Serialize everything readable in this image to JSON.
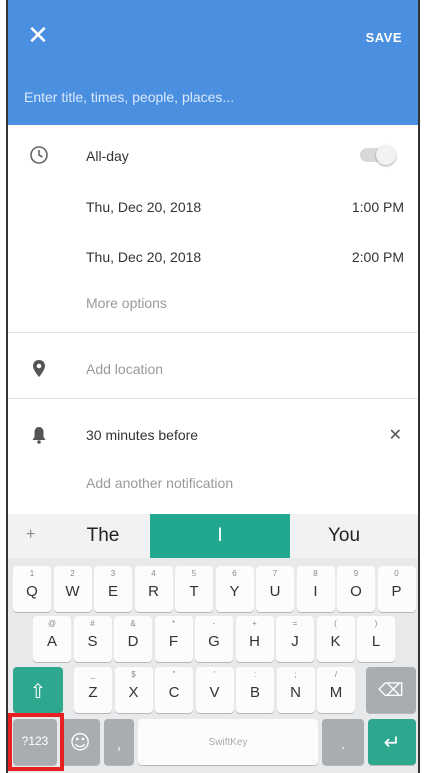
{
  "header": {
    "close_glyph": "✕",
    "save_label": "SAVE",
    "title_placeholder": "Enter title, times, people, places..."
  },
  "event": {
    "allday_label": "All-day",
    "allday_on": false,
    "start_date": "Thu, Dec 20, 2018",
    "start_time": "1:00 PM",
    "end_date": "Thu, Dec 20, 2018",
    "end_time": "2:00 PM",
    "more_options": "More options",
    "location_placeholder": "Add location",
    "notification": "30 minutes before",
    "notification_clear": "✕",
    "add_notification": "Add another notification"
  },
  "keyboard": {
    "suggestions": [
      "The",
      "I",
      "You"
    ],
    "row1": [
      {
        "k": "Q",
        "h": "1"
      },
      {
        "k": "W",
        "h": "2"
      },
      {
        "k": "E",
        "h": "3"
      },
      {
        "k": "R",
        "h": "4"
      },
      {
        "k": "T",
        "h": "5"
      },
      {
        "k": "Y",
        "h": "6"
      },
      {
        "k": "U",
        "h": "7"
      },
      {
        "k": "I",
        "h": "8"
      },
      {
        "k": "O",
        "h": "9"
      },
      {
        "k": "P",
        "h": "0"
      }
    ],
    "row2": [
      {
        "k": "A",
        "h": "@"
      },
      {
        "k": "S",
        "h": "#"
      },
      {
        "k": "D",
        "h": "&"
      },
      {
        "k": "F",
        "h": "*"
      },
      {
        "k": "G",
        "h": "-"
      },
      {
        "k": "H",
        "h": "+"
      },
      {
        "k": "J",
        "h": "="
      },
      {
        "k": "K",
        "h": "("
      },
      {
        "k": "L",
        "h": ")"
      }
    ],
    "row3": [
      {
        "k": "Z",
        "h": "_"
      },
      {
        "k": "X",
        "h": "$"
      },
      {
        "k": "C",
        "h": "\""
      },
      {
        "k": "V",
        "h": "'"
      },
      {
        "k": "B",
        "h": ":"
      },
      {
        "k": "N",
        "h": ";"
      },
      {
        "k": "M",
        "h": "/"
      }
    ],
    "shift_glyph": "⇧",
    "backspace_glyph": "⌫",
    "numbers_label": "?123",
    "emoji_glyph": "☺",
    "comma": ",",
    "space_label": "SwiftKey",
    "period": ".",
    "enter_glyph": "↵"
  },
  "colors": {
    "header": "#4a8fe0",
    "suggestion_highlight": "#22a88e",
    "callout_border": "#e62020"
  }
}
